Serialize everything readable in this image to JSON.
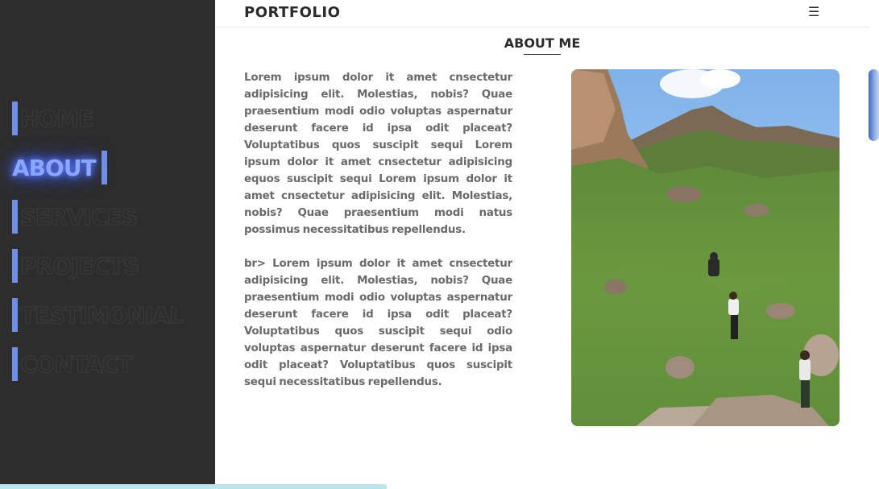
{
  "header": {
    "brand": "PORTFOLIO",
    "menu_icon": "hamburger-icon",
    "menu_glyph": "☰"
  },
  "sidebar": {
    "items": [
      {
        "label": "HOME",
        "active": false
      },
      {
        "label": "ABOUT",
        "active": true
      },
      {
        "label": "SERVICES",
        "active": false
      },
      {
        "label": "PROJECTS",
        "active": false
      },
      {
        "label": "TESTIMONIAL",
        "active": false
      },
      {
        "label": "CONTACT",
        "active": false
      }
    ]
  },
  "about": {
    "title": "ABOUT ME",
    "paragraphs": [
      "Lorem ipsum dolor it amet cnsectetur adipisicing elit. Molestias, nobis? Quae praesentium modi odio voluptas aspernatur deserunt facere id ipsa odit placeat? Voluptatibus quos suscipit sequi Lorem ipsum dolor it amet cnsectetur adipisicing equos suscipit sequi Lorem ipsum dolor it amet cnsectetur adipisicing elit. Molestias, nobis? Quae praesentium modi natus possimus necessitatibus repellendus.",
      "br> Lorem ipsum dolor it amet cnsectetur adipisicing elit. Molestias, nobis? Quae praesentium modi odio voluptas aspernatur deserunt facere id ipsa odit placeat? Voluptatibus quos suscipit sequi odio voluptas aspernatur deserunt facere id ipsa odit placeat? Voluptatibus quos suscipit sequi necessitatibus repellendus."
    ]
  },
  "colors": {
    "sidebar_bg": "#2d2d2d",
    "accent": "#6f8ee8",
    "active_glow": "#8aa6ff",
    "progress": "#b8e6ec"
  },
  "scroll_progress": 0.44
}
